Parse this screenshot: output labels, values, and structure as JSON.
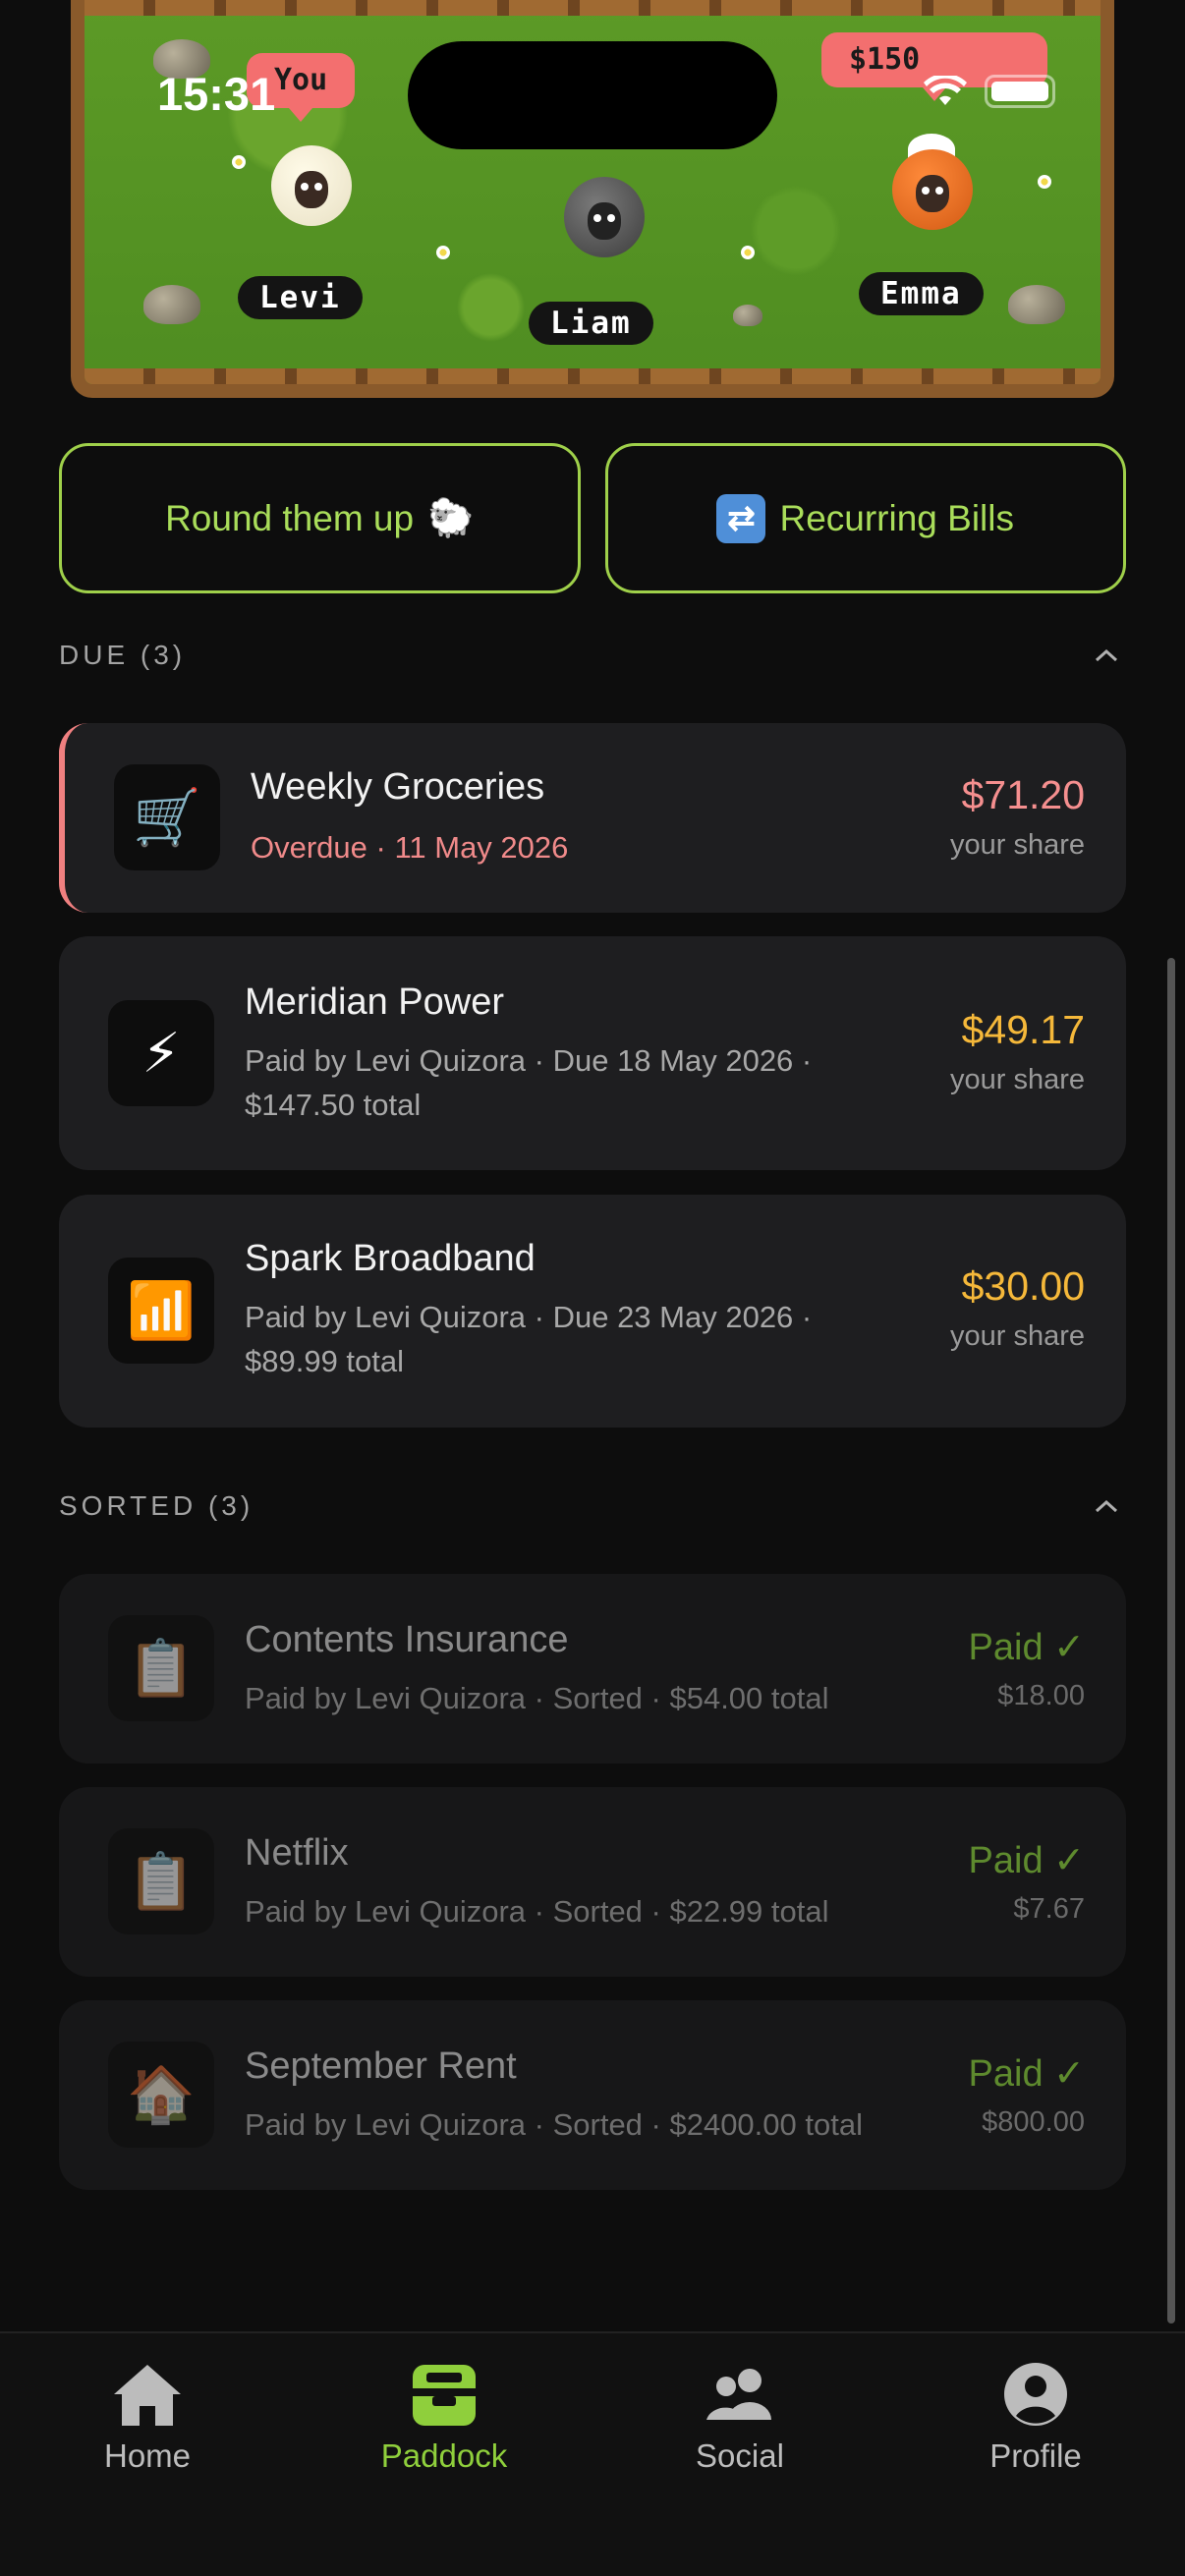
{
  "status_bar": {
    "time": "15:31"
  },
  "scene": {
    "speech_you": "You",
    "speech_money": "$150",
    "sheep": [
      {
        "name": "Levi"
      },
      {
        "name": "Liam"
      },
      {
        "name": "Emma"
      }
    ]
  },
  "actions": {
    "round_up_label": "Round them up",
    "round_up_emoji": "🐑",
    "recurring_label": "Recurring Bills"
  },
  "due": {
    "header": "DUE (3)",
    "bills": [
      {
        "icon": "cart-icon",
        "glyph": "🛒",
        "title": "Weekly Groceries",
        "subtitle": "Overdue · 11 May 2026",
        "amount": "$71.20",
        "share_label": "your share"
      },
      {
        "icon": "lightning-icon",
        "glyph": "⚡",
        "title": "Meridian Power",
        "subtitle": "Paid by Levi Quizora · Due 18 May 2026 · $147.50 total",
        "amount": "$49.17",
        "share_label": "your share"
      },
      {
        "icon": "signal-bars-icon",
        "glyph": "📶",
        "title": "Spark Broadband",
        "subtitle": "Paid by Levi Quizora · Due 23 May 2026 · $89.99 total",
        "amount": "$30.00",
        "share_label": "your share"
      }
    ]
  },
  "sorted": {
    "header": "SORTED (3)",
    "bills": [
      {
        "icon": "clipboard-icon",
        "glyph": "📋",
        "title": "Contents Insurance",
        "subtitle": "Paid by Levi Quizora · Sorted · $54.00 total",
        "status": "Paid ✓",
        "amount": "$18.00"
      },
      {
        "icon": "clipboard-icon",
        "glyph": "📋",
        "title": "Netflix",
        "subtitle": "Paid by Levi Quizora · Sorted · $22.99 total",
        "status": "Paid ✓",
        "amount": "$7.67"
      },
      {
        "icon": "house-icon",
        "glyph": "🏠",
        "title": "September Rent",
        "subtitle": "Paid by Levi Quizora · Sorted · $2400.00 total",
        "status": "Paid ✓",
        "amount": "$800.00"
      }
    ]
  },
  "tabbar": {
    "tabs": [
      {
        "label": "Home",
        "icon": "home-icon"
      },
      {
        "label": "Paddock",
        "icon": "barn-icon",
        "active": true
      },
      {
        "label": "Social",
        "icon": "people-icon"
      },
      {
        "label": "Profile",
        "icon": "person-icon"
      }
    ]
  },
  "colors": {
    "accent_green": "#9fd04a",
    "overdue_red": "#f08a8a",
    "due_gold": "#f5b83a",
    "paid_green": "#5e8a2e"
  }
}
